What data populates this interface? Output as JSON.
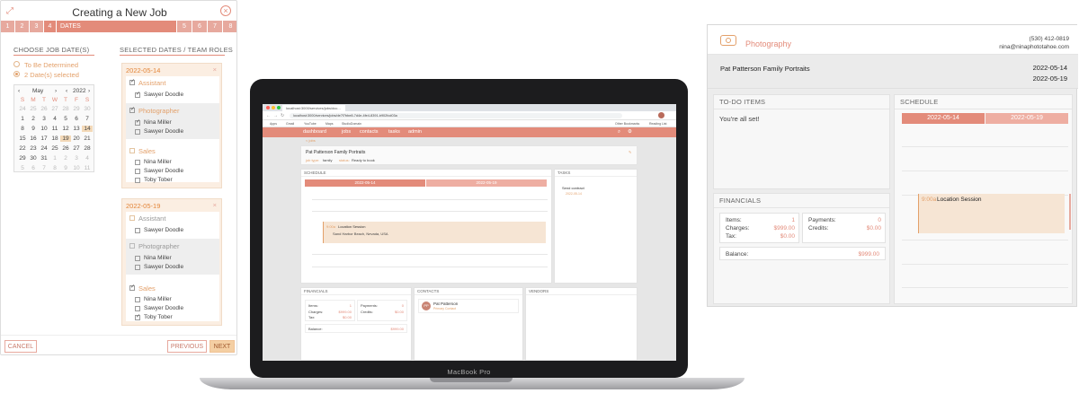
{
  "wizard": {
    "title": "Creating a New Job",
    "steps": [
      "1",
      "2",
      "3",
      "4",
      "DATES",
      "5",
      "6",
      "7",
      "8"
    ],
    "choose_heading": "CHOOSE JOB DATE(S)",
    "selected_heading": "SELECTED DATES / TEAM ROLES",
    "option_tbd": "To Be Determined",
    "option_selected": "2 Date(s) selected",
    "calendar": {
      "month": "May",
      "year": "2022",
      "dow": [
        "S",
        "M",
        "T",
        "W",
        "T",
        "F",
        "S"
      ],
      "rows": [
        [
          "24",
          "25",
          "26",
          "27",
          "28",
          "29",
          "30"
        ],
        [
          "1",
          "2",
          "3",
          "4",
          "5",
          "6",
          "7"
        ],
        [
          "8",
          "9",
          "10",
          "11",
          "12",
          "13",
          "14"
        ],
        [
          "15",
          "16",
          "17",
          "18",
          "19",
          "20",
          "21"
        ],
        [
          "22",
          "23",
          "24",
          "25",
          "26",
          "27",
          "28"
        ],
        [
          "29",
          "30",
          "31",
          "1",
          "2",
          "3",
          "4"
        ],
        [
          "5",
          "6",
          "7",
          "8",
          "9",
          "10",
          "11"
        ]
      ]
    },
    "dates": [
      {
        "date": "2022-05-14",
        "roles": [
          {
            "name": "Assistant",
            "members": [
              "Sawyer Doodle"
            ]
          },
          {
            "name": "Photographer",
            "members": [
              "Nina Miller",
              "Sawyer Doodle"
            ]
          },
          {
            "name": "Sales",
            "members": [
              "Nina Miller",
              "Sawyer Doodle",
              "Toby Tober"
            ]
          }
        ]
      },
      {
        "date": "2022-05-19",
        "roles": [
          {
            "name": "Assistant",
            "members": [
              "Sawyer Doodle"
            ]
          },
          {
            "name": "Photographer",
            "members": [
              "Nina Miller",
              "Sawyer Doodle"
            ]
          },
          {
            "name": "Sales",
            "members": [
              "Nina Miller",
              "Sawyer Doodle",
              "Toby Tober"
            ]
          }
        ]
      }
    ],
    "cancel": "CANCEL",
    "previous": "PREVIOUS",
    "next": "NEXT"
  },
  "laptop": {
    "brand": "MacBook Pro",
    "browser": {
      "tab": "localhost:3000/services/jobs/dcc...",
      "url": "localhost:3000/services/jobs/de7f7bbe8-7d4e-4fe4-8391-b902fcd03a",
      "bookmarks": [
        "Apps",
        "Gmail",
        "YouTube",
        "Maps",
        "StudioDomain",
        "Other Bookmarks",
        "Reading List"
      ]
    },
    "nav": [
      "dashboard",
      "jobs",
      "contacts",
      "tasks",
      "admin"
    ],
    "crumb": "< jobs",
    "job": {
      "title": "Pat Patterson Family Portraits",
      "type_label": "job type:",
      "type": "family",
      "status_label": "status:",
      "status": "Ready to book"
    },
    "schedule": {
      "heading": "SCHEDULE",
      "dates": [
        "2022-05-14",
        "2022-05-19"
      ],
      "event_time": "9:00a",
      "event_title": "Location Session",
      "event_place": "Sand Harbor Beach, Nevada, USA"
    },
    "tasks": {
      "heading": "TASKS",
      "item": "Send contract",
      "meta": "2022-05-14"
    },
    "financials": {
      "heading": "FINANCIALS",
      "items_label": "Items:",
      "items": "1",
      "charges_label": "Charges:",
      "charges": "$999.00",
      "tax_label": "Tax:",
      "tax": "$0.00",
      "payments_label": "Payments:",
      "payments": "0",
      "credits_label": "Credits:",
      "credits": "$0.00",
      "balance_label": "Balance:",
      "balance": "$999.00"
    },
    "contacts": {
      "heading": "CONTACTS",
      "name": "Pat Patterson",
      "role": "Primary Contact",
      "initials": "PP"
    },
    "vendors": {
      "heading": "VENDORS"
    }
  },
  "portal": {
    "brand": "Photography",
    "phone": "(530) 412-0819",
    "email": "nina@ninaphototahoe.com",
    "job_title": "Pat Patterson Family Portraits",
    "dates": [
      "2022-05-14",
      "2022-05-19"
    ],
    "todo_heading": "TO-DO ITEMS",
    "todo_text": "You're all set!",
    "schedule_heading": "SCHEDULE",
    "event_time": "9:00a",
    "event_title": "Location Session",
    "financials_heading": "FINANCIALS",
    "items_label": "Items:",
    "items": "1",
    "charges_label": "Charges:",
    "charges": "$999.00",
    "tax_label": "Tax:",
    "tax": "$0.00",
    "payments_label": "Payments:",
    "payments": "0",
    "credits_label": "Credits:",
    "credits": "$0.00",
    "balance_label": "Balance:",
    "balance": "$999.00"
  }
}
